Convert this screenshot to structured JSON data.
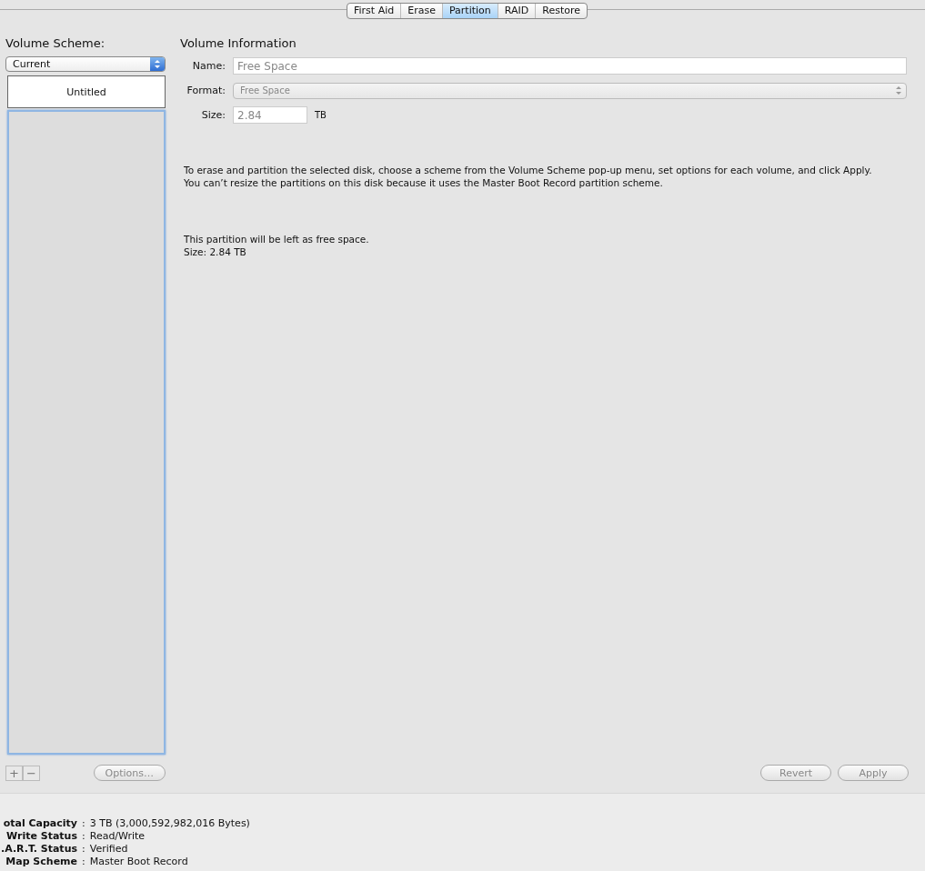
{
  "tabs": [
    {
      "label": "First Aid",
      "selected": false
    },
    {
      "label": "Erase",
      "selected": false
    },
    {
      "label": "Partition",
      "selected": true
    },
    {
      "label": "RAID",
      "selected": false
    },
    {
      "label": "Restore",
      "selected": false
    }
  ],
  "volume_scheme": {
    "label": "Volume Scheme:",
    "value": "Current",
    "partitions": [
      {
        "kind": "volume",
        "label": "Untitled",
        "selected": false
      },
      {
        "kind": "free",
        "selected": true
      }
    ],
    "add_label": "+",
    "remove_label": "−",
    "options_button": {
      "label": "Options…",
      "disabled": true
    }
  },
  "volume_information": {
    "title": "Volume Information",
    "name": {
      "label": "Name:",
      "value": "Free Space",
      "disabled": true
    },
    "format": {
      "label": "Format:",
      "value": "Free Space",
      "disabled": true
    },
    "size": {
      "label": "Size:",
      "value": "2.84",
      "unit": "TB",
      "disabled": true
    },
    "instructions": [
      "To erase and partition the selected disk, choose a scheme from the Volume Scheme pop-up menu, set options for each volume, and click Apply.",
      "You can’t resize the partitions on this disk because it uses the Master Boot Record partition scheme."
    ],
    "details": [
      "This partition will be left as free space.",
      "Size: 2.84 TB"
    ],
    "buttons": [
      {
        "label": "Revert",
        "disabled": true
      },
      {
        "label": "Apply",
        "disabled": true
      }
    ]
  },
  "disk_info": [
    {
      "label": "otal Capacity",
      "separator": ":",
      "value": "3 TB (3,000,592,982,016 Bytes)"
    },
    {
      "label": "Write Status",
      "separator": ":",
      "value": "Read/Write"
    },
    {
      "label": ".A.R.T. Status",
      "separator": ":",
      "value": "Verified"
    },
    {
      "label": "Map Scheme",
      "separator": ":",
      "value": "Master Boot Record"
    }
  ]
}
